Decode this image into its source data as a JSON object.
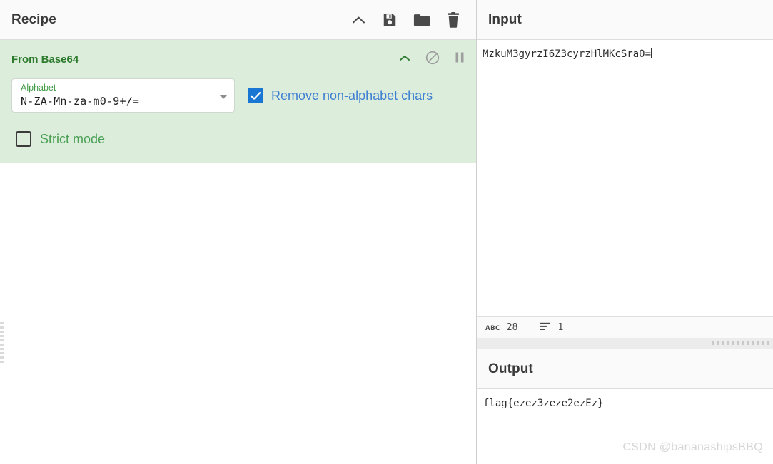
{
  "recipe": {
    "title": "Recipe",
    "actions": [
      {
        "name": "collapse-icon",
        "label": "Collapse"
      },
      {
        "name": "save-icon",
        "label": "Save recipe"
      },
      {
        "name": "load-icon",
        "label": "Load recipe"
      },
      {
        "name": "clear-icon",
        "label": "Clear recipe"
      }
    ],
    "operation": {
      "name": "From Base64",
      "icons": [
        {
          "name": "chevron-up-icon",
          "label": "Hide arguments"
        },
        {
          "name": "disable-icon",
          "label": "Disable operation"
        },
        {
          "name": "pause-icon",
          "label": "Set breakpoint"
        }
      ],
      "args": {
        "alphabet": {
          "label": "Alphabet",
          "value": "N-ZA-Mn-za-m0-9+/="
        },
        "remove_non_alphabet": {
          "label": "Remove non-alphabet chars",
          "checked": true
        },
        "strict_mode": {
          "label": "Strict mode",
          "checked": false
        }
      }
    }
  },
  "input": {
    "title": "Input",
    "value": "MzkuM3gyrzI6Z3cyrzHlMKcSra0=",
    "status": {
      "length_icon": "abc-icon",
      "length": "28",
      "lines_icon": "lines-icon",
      "lines": "1"
    }
  },
  "output": {
    "title": "Output",
    "value": "flag{ezez3zeze2ezEz}"
  },
  "watermark": {
    "text": "CSDN @bananashipsBBQ"
  },
  "colors": {
    "operation_bg": "#dceddc",
    "operation_title": "#2c7a2c",
    "checkbox_accent": "#1976d2",
    "checkbox_label_blue": "#3f7fd1",
    "label_green": "#3f9b45"
  }
}
